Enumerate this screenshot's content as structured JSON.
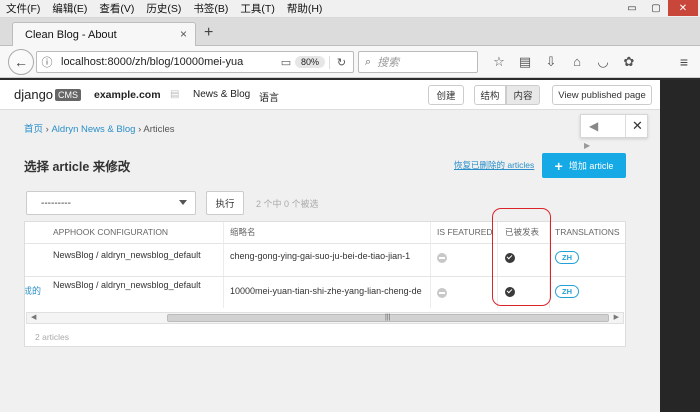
{
  "menu": [
    "文件(F)",
    "编辑(E)",
    "查看(V)",
    "历史(S)",
    "书签(B)",
    "工具(T)",
    "帮助(H)"
  ],
  "window_controls": {
    "minimize": "▭",
    "restore": "▢",
    "close": "✕"
  },
  "tab": {
    "title": "Clean Blog - About",
    "close": "×",
    "new": "+"
  },
  "address": {
    "url": "localhost:8000/zh/blog/10000mei-yua",
    "zoom": "80%"
  },
  "search": {
    "placeholder": "搜索"
  },
  "cms": {
    "logo_text": "django",
    "logo_badge": "CMS",
    "site": "example.com",
    "menu_newsblog": "News & Blog",
    "menu_language": "语言",
    "btn_create": "创建",
    "btn_structure": "结构",
    "btn_content": "内容",
    "btn_view_published": "View published page"
  },
  "breadcrumb": {
    "home": "首页",
    "app": "Aldryn News & Blog",
    "current": "Articles",
    "sep": "›"
  },
  "page_title": "选择 article 来修改",
  "recover_link": "恢复已删除的 articles",
  "add_button": {
    "plus": "+",
    "label": "增加 article"
  },
  "action_select": {
    "value": "---------"
  },
  "go_button": "执行",
  "selection_counter": "2 个中 0 个被选",
  "table": {
    "headers": [
      "APPHOOK CONFIGURATION",
      "缩略名",
      "IS FEATURED",
      "已被发表",
      "TRANSLATIONS"
    ],
    "rows": [
      {
        "title_fragment": "",
        "apphook": "NewsBlog / aldryn_newsblog_default",
        "slug": "cheng-gong-ying-gai-suo-ju-bei-de-tiao-jian-1",
        "is_featured": false,
        "published": true,
        "translation": "ZH"
      },
      {
        "title_fragment": "成的",
        "apphook": "NewsBlog / aldryn_newsblog_default",
        "slug": "10000mei-yuan-tian-shi-zhe-yang-lian-cheng-de",
        "is_featured": false,
        "published": true,
        "translation": "ZH"
      }
    ]
  },
  "footer_count": "2 articles",
  "colors": {
    "accent": "#15a9e6",
    "highlight": "#d9252a",
    "link": "#2a8fc9"
  }
}
